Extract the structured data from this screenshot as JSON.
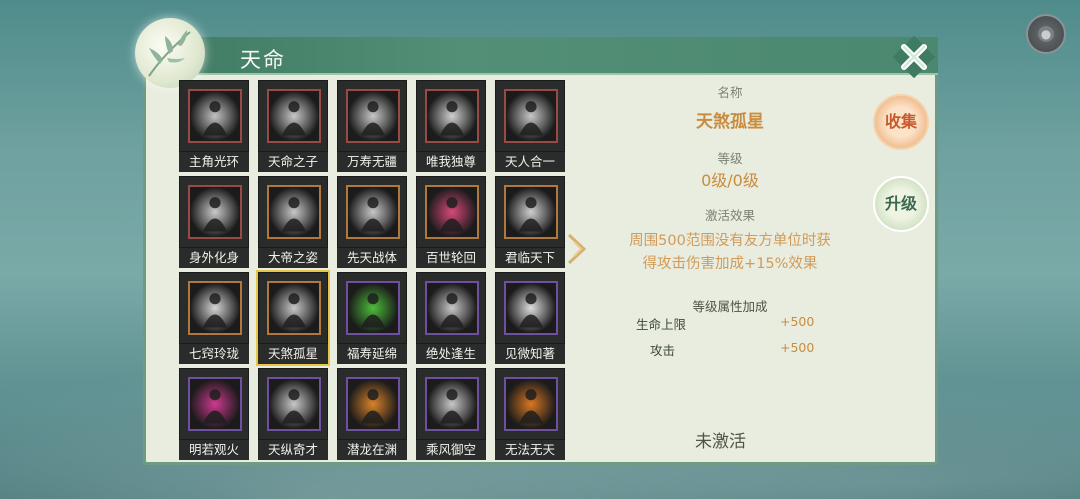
{
  "header": {
    "title": "天命"
  },
  "skills": [
    {
      "name": "主角光环",
      "border": "#9a4a45",
      "art": "#c9c9c9"
    },
    {
      "name": "天命之子",
      "border": "#9a4a45",
      "art": "#cfcfcf"
    },
    {
      "name": "万寿无疆",
      "border": "#9a4a45",
      "art": "#cfcfcf"
    },
    {
      "name": "唯我独尊",
      "border": "#9a4a45",
      "art": "#d8d8d8"
    },
    {
      "name": "天人合一",
      "border": "#9a4a45",
      "art": "#cfcfcf"
    },
    {
      "name": "身外化身",
      "border": "#9a4a45",
      "art": "#d2d2d2"
    },
    {
      "name": "大帝之姿",
      "border": "#b1783c",
      "art": "#cfcfcf"
    },
    {
      "name": "先天战体",
      "border": "#b1783c",
      "art": "#cfcfcf"
    },
    {
      "name": "百世轮回",
      "border": "#b1783c",
      "art": "#e04a7c"
    },
    {
      "name": "君临天下",
      "border": "#b1783c",
      "art": "#d6d6d6"
    },
    {
      "name": "七窍玲珑",
      "border": "#b1783c",
      "art": "#dcdcdc"
    },
    {
      "name": "天煞孤星",
      "border": "#b1783c",
      "art": "#cfcfcf"
    },
    {
      "name": "福寿延绵",
      "border": "#6e4fa0",
      "art": "#4fc43a"
    },
    {
      "name": "绝处逢生",
      "border": "#6e4fa0",
      "art": "#cfcfcf"
    },
    {
      "name": "见微知著",
      "border": "#6e4fa0",
      "art": "#e6e6e6"
    },
    {
      "name": "明若观火",
      "border": "#6e4fa0",
      "art": "#d63a94"
    },
    {
      "name": "天纵奇才",
      "border": "#6e4fa0",
      "art": "#cfcfcf"
    },
    {
      "name": "潜龙在渊",
      "border": "#6e4fa0",
      "art": "#e2862a"
    },
    {
      "name": "乘风御空",
      "border": "#6e4fa0",
      "art": "#cfcfcf"
    },
    {
      "name": "无法无天",
      "border": "#6e4fa0",
      "art": "#e07a22"
    }
  ],
  "selected_index": 11,
  "detail": {
    "name_label": "名称",
    "name_value": "天煞孤星",
    "level_label": "等级",
    "level_value": "0级/0级",
    "effect_label": "激活效果",
    "effect_line1": "周围500范围没有友方单位时获",
    "effect_line2": "得攻击伤害加成+15%效果",
    "attr_label": "等级属性加成",
    "attrs": [
      {
        "name": "生命上限",
        "value": "+500"
      },
      {
        "name": "攻击",
        "value": "+500"
      }
    ],
    "status": "未激活"
  },
  "buttons": {
    "collect": "收集",
    "upgrade": "升级"
  },
  "colors": {
    "accent": "#c98c3f",
    "panel": "#e9eddf",
    "title_bar": "#4b8870"
  },
  "icons": {
    "close": "close-icon",
    "settings": "round-menu-icon",
    "arrow": "chevron-right-icon"
  }
}
